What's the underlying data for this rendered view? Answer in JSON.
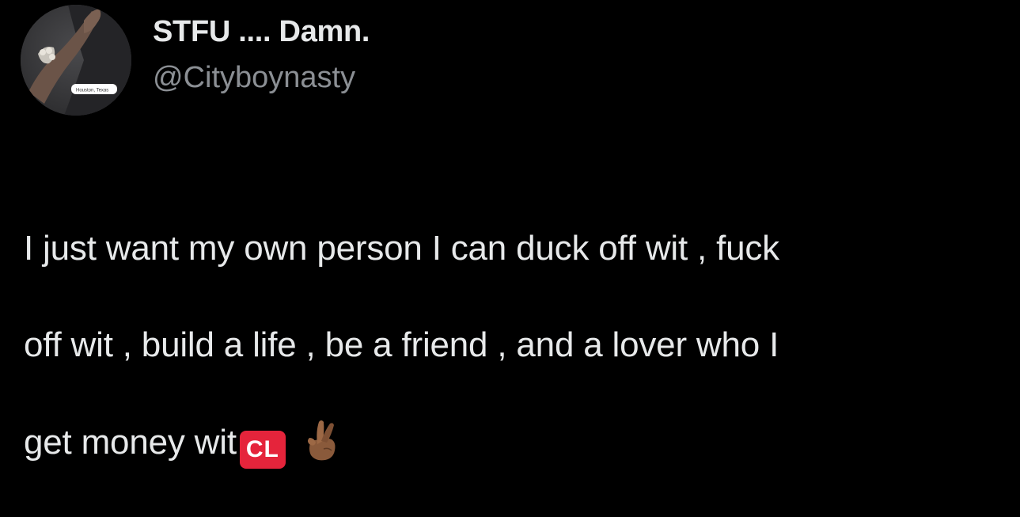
{
  "tweet": {
    "author": {
      "display_name": "STFU .... Damn.",
      "handle": "@Cityboynasty",
      "avatar_badge_text": "Houston, Texas"
    },
    "text_lines": [
      "I just want my own person I can duck off wit , fuck",
      "off wit , build a life , be a friend , and a lover who I",
      "get money wit"
    ],
    "emojis": {
      "badge_text": "CL",
      "badge_icon": "cl-button-emoji",
      "hand_icon": "crossed-fingers-emoji"
    }
  }
}
